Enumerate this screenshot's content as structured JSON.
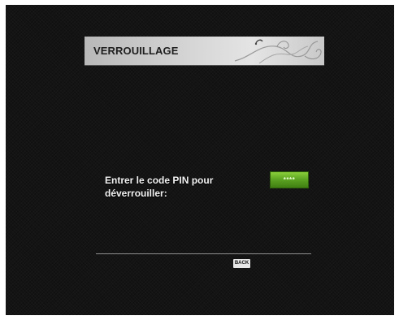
{
  "header": {
    "title": "VERROUILLAGE"
  },
  "pin_prompt": {
    "label_line1": "Entrer le code PIN pour",
    "label_line2": "déverrouiller:",
    "masked_value": "****"
  },
  "footer": {
    "back_label": "BACK"
  },
  "colors": {
    "background": "#141414",
    "header_bar": "#d6d6d6",
    "pin_field": "#5ea523",
    "text": "#f2f2f2"
  }
}
